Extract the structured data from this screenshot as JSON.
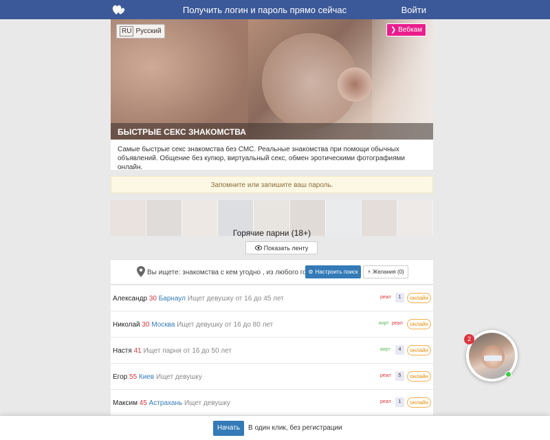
{
  "topbar": {
    "center_text": "Получить логин и пароль прямо сейчас",
    "login_label": "Войти",
    "logo_icon": "hearts-logo-icon"
  },
  "hero": {
    "lang_code": "RU",
    "lang_label": "Русский",
    "webcam_label": "❯ Вебкам",
    "title": "БЫСТРЫЕ СЕКС ЗНАКОМСТВА"
  },
  "description": "Самые быстрые секс знакомства без СМС. Реальные знакомства при помощи обычных объявлений. Общение без купюр, виртуальный секс, обмен эротическими фотографиями онлайн.",
  "notice": "Запомните или запишите ваш пароль.",
  "hot": {
    "title": "Горячие парни (18+)",
    "feed_button": "Показать ленту",
    "feed_icon": "eye-icon"
  },
  "search": {
    "text": "Вы ищете: знакомства с кем угодно , из любого города",
    "setup_button": "Настроить поиск",
    "setup_icon": "gear-icon",
    "wish_button": "Желания (0)",
    "wish_icon": "bolt-icon"
  },
  "rows": [
    {
      "name": "Александр",
      "age": "30",
      "city": "Барнаул",
      "seek": "Ищет девушку от 16 до 45 лет",
      "tags": [
        "реал"
      ],
      "count": "1",
      "status": "онлайн"
    },
    {
      "name": "Николай",
      "age": "30",
      "city": "Москва",
      "seek": "Ищет девушку от 16 до 80 лет",
      "tags": [
        "вирт",
        "реал"
      ],
      "count": "",
      "status": "онлайн"
    },
    {
      "name": "Настя",
      "age": "41",
      "city": "",
      "seek": "Ищет парня от 16 до 50 лет",
      "tags": [
        "вирт"
      ],
      "count": "4",
      "status": "онлайн"
    },
    {
      "name": "Егор",
      "age": "55",
      "city": "Киев",
      "seek": "Ищет девушку",
      "tags": [
        "реал"
      ],
      "count": "5",
      "status": "онлайн"
    },
    {
      "name": "Максим",
      "age": "45",
      "city": "Астрахань",
      "seek": "Ищет девушку",
      "tags": [
        "реал"
      ],
      "count": "1",
      "status": "онлайн"
    }
  ],
  "footer": {
    "start_button": "Начать",
    "text": "В один клик, без регистрации"
  },
  "chat": {
    "badge": "2"
  },
  "colors": {
    "topbar": "#3b5998",
    "accent_blue": "#337ab7",
    "age_red": "#d9363e",
    "webcam_pink": "#e91e8c",
    "online_orange": "#f0ad4e"
  }
}
